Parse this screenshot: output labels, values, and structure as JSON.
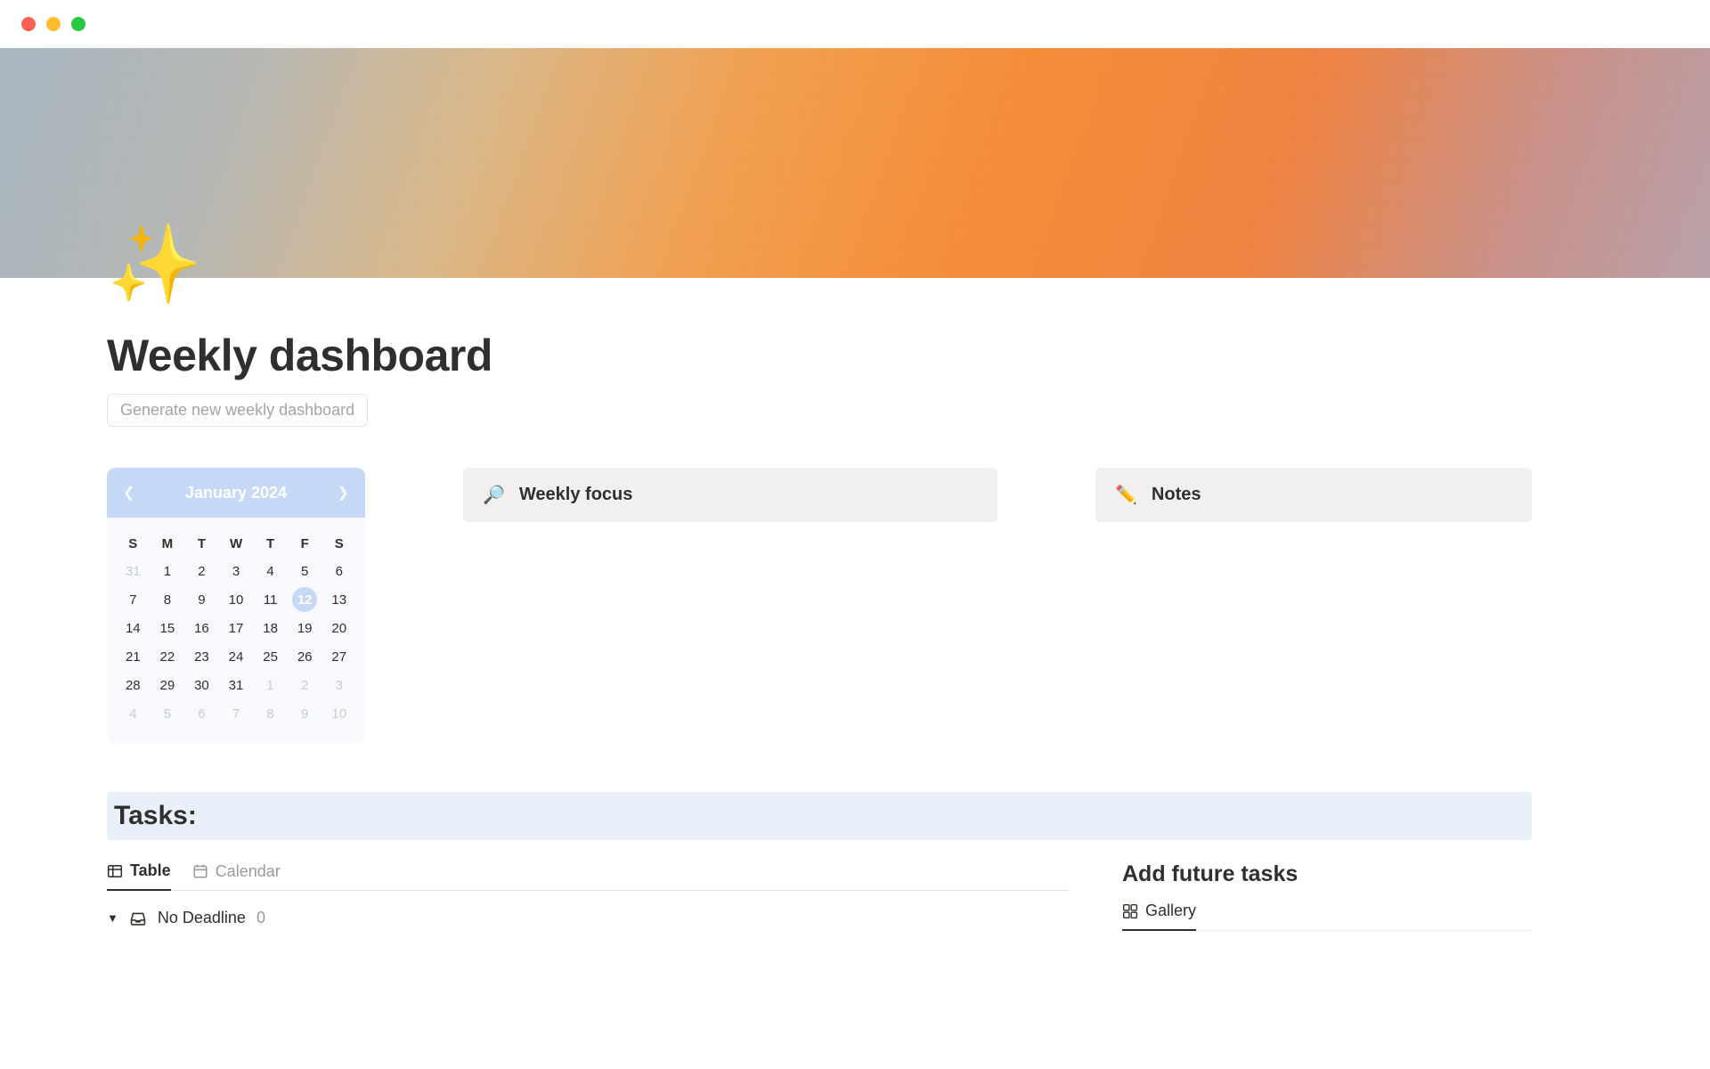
{
  "page": {
    "icon": "✨",
    "title": "Weekly dashboard",
    "generate_button": "Generate new weekly dashboard"
  },
  "calendar": {
    "month_label": "January 2024",
    "dow": [
      "S",
      "M",
      "T",
      "W",
      "T",
      "F",
      "S"
    ],
    "weeks": [
      [
        {
          "d": "31",
          "muted": true
        },
        {
          "d": "1"
        },
        {
          "d": "2"
        },
        {
          "d": "3"
        },
        {
          "d": "4"
        },
        {
          "d": "5"
        },
        {
          "d": "6"
        }
      ],
      [
        {
          "d": "7"
        },
        {
          "d": "8"
        },
        {
          "d": "9"
        },
        {
          "d": "10"
        },
        {
          "d": "11"
        },
        {
          "d": "12",
          "today": true
        },
        {
          "d": "13"
        }
      ],
      [
        {
          "d": "14"
        },
        {
          "d": "15"
        },
        {
          "d": "16"
        },
        {
          "d": "17"
        },
        {
          "d": "18"
        },
        {
          "d": "19"
        },
        {
          "d": "20"
        }
      ],
      [
        {
          "d": "21"
        },
        {
          "d": "22"
        },
        {
          "d": "23"
        },
        {
          "d": "24"
        },
        {
          "d": "25"
        },
        {
          "d": "26"
        },
        {
          "d": "27"
        }
      ],
      [
        {
          "d": "28"
        },
        {
          "d": "29"
        },
        {
          "d": "30"
        },
        {
          "d": "31"
        },
        {
          "d": "1",
          "muted": true
        },
        {
          "d": "2",
          "muted": true
        },
        {
          "d": "3",
          "muted": true
        }
      ],
      [
        {
          "d": "4",
          "muted": true
        },
        {
          "d": "5",
          "muted": true
        },
        {
          "d": "6",
          "muted": true
        },
        {
          "d": "7",
          "muted": true
        },
        {
          "d": "8",
          "muted": true
        },
        {
          "d": "9",
          "muted": true
        },
        {
          "d": "10",
          "muted": true
        }
      ]
    ]
  },
  "widgets": {
    "focus": {
      "icon": "🔎",
      "title": "Weekly focus"
    },
    "notes": {
      "icon": "✏️",
      "title": "Notes"
    }
  },
  "tasks": {
    "heading": "Tasks:",
    "views": {
      "table": "Table",
      "calendar": "Calendar"
    },
    "group": {
      "label": "No Deadline",
      "count": "0"
    }
  },
  "future": {
    "title": "Add future tasks",
    "gallery_tab": "Gallery"
  }
}
